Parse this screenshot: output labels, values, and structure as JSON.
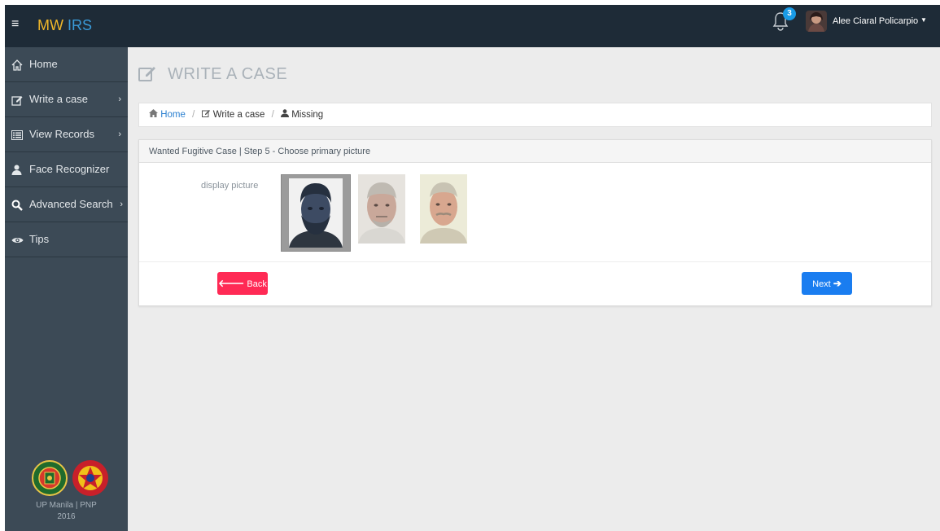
{
  "app": {
    "brand_part1": "MW",
    "brand_part2": "IRS",
    "hamburger": "≡"
  },
  "navbar": {
    "notification_count": "3",
    "user_name": "Alee Ciaral Policarpio",
    "caret": "▼"
  },
  "sidebar": {
    "items": [
      {
        "label": "Home",
        "icon": "home-icon"
      },
      {
        "label": "Write a case",
        "icon": "edit-icon",
        "chevron": "›"
      },
      {
        "label": "View Records",
        "icon": "list-icon",
        "chevron": "›"
      },
      {
        "label": "Face Recognizer",
        "icon": "user-icon"
      },
      {
        "label": "Advanced Search",
        "icon": "search-icon",
        "chevron": "›"
      },
      {
        "label": "Tips",
        "icon": "eye-icon"
      }
    ],
    "footer_line1": "UP Manila | PNP",
    "footer_line2": "2016"
  },
  "page": {
    "title": "WRITE A CASE"
  },
  "breadcrumb": {
    "home": "Home",
    "sep": "/",
    "write": "Write a case",
    "missing": "Missing"
  },
  "panel": {
    "heading": "Wanted Fugitive Case | Step 5 - Choose primary picture",
    "field_label": "display picture",
    "selected_index": 0
  },
  "buttons": {
    "back": "Back",
    "back_arrow": "🡐",
    "next": "Next",
    "next_arrow": "➔"
  },
  "colors": {
    "navbar": "#1e2b37",
    "sidebar": "#3c4a56",
    "brand_primary": "#f0b72a",
    "brand_secondary": "#3a9bd9",
    "back_button": "#ff2a55",
    "next_button": "#1a7df0",
    "badge": "#1a9be6"
  }
}
